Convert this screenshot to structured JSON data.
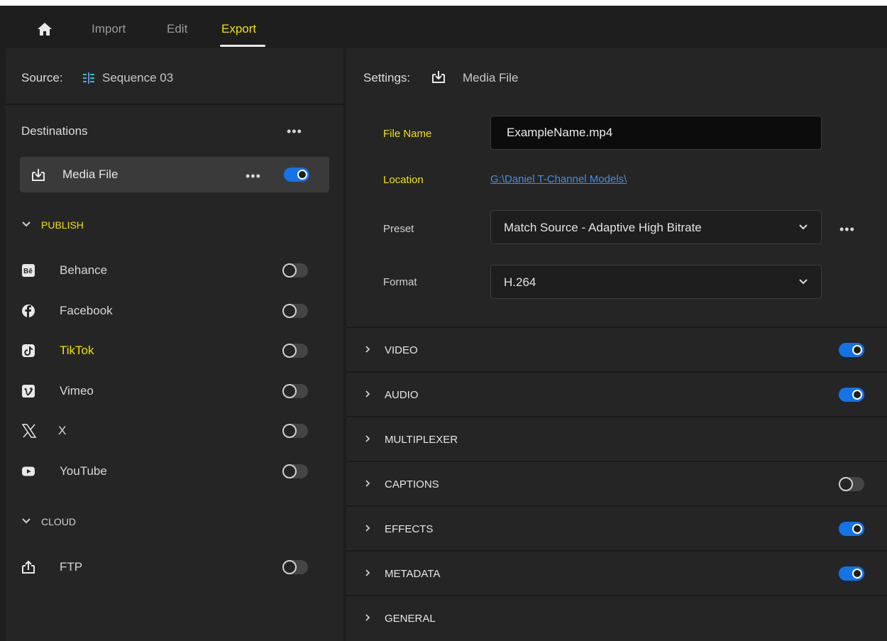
{
  "topbar": {
    "home_icon": "home-icon",
    "tabs": [
      {
        "label": "Import",
        "active": false
      },
      {
        "label": "Edit",
        "active": false
      },
      {
        "label": "Export",
        "active": true
      }
    ]
  },
  "source": {
    "label": "Source:",
    "icon": "sequence-icon",
    "name": "Sequence 03"
  },
  "destinations": {
    "title": "Destinations",
    "more": "•••",
    "media_file": {
      "label": "Media File",
      "icon": "media-export-icon",
      "more": "•••",
      "enabled": true
    },
    "publish_header": "PUBLISH",
    "publish_items": [
      {
        "label": "Behance",
        "icon": "behance-icon",
        "enabled": false,
        "highlight": false
      },
      {
        "label": "Facebook",
        "icon": "facebook-icon",
        "enabled": false,
        "highlight": false
      },
      {
        "label": "TikTok",
        "icon": "tiktok-icon",
        "enabled": false,
        "highlight": true
      },
      {
        "label": "Vimeo",
        "icon": "vimeo-icon",
        "enabled": false,
        "highlight": false
      },
      {
        "label": "X",
        "icon": "x-icon",
        "enabled": false,
        "highlight": false
      },
      {
        "label": "YouTube",
        "icon": "youtube-icon",
        "enabled": false,
        "highlight": false
      }
    ],
    "cloud_header": "CLOUD",
    "cloud_items": [
      {
        "label": "FTP",
        "icon": "upload-icon",
        "enabled": false
      }
    ]
  },
  "settings": {
    "label": "Settings:",
    "icon": "media-export-icon",
    "name": "Media File",
    "file_name_label": "File Name",
    "file_name_value": "ExampleName.mp4",
    "location_label": "Location",
    "location_value": "G:\\Daniel T-Channel Models\\",
    "preset_label": "Preset",
    "preset_value": "Match Source - Adaptive High Bitrate",
    "preset_more": "•••",
    "format_label": "Format",
    "format_value": "H.264"
  },
  "sections": [
    {
      "label": "VIDEO",
      "toggle": "on"
    },
    {
      "label": "AUDIO",
      "toggle": "on"
    },
    {
      "label": "MULTIPLEXER",
      "toggle": "none"
    },
    {
      "label": "CAPTIONS",
      "toggle": "off"
    },
    {
      "label": "EFFECTS",
      "toggle": "on"
    },
    {
      "label": "METADATA",
      "toggle": "on"
    },
    {
      "label": "GENERAL",
      "toggle": "none"
    }
  ],
  "colors": {
    "accent_yellow": "#f2e200",
    "toggle_on": "#1473e6",
    "link": "#3f8fe6"
  }
}
